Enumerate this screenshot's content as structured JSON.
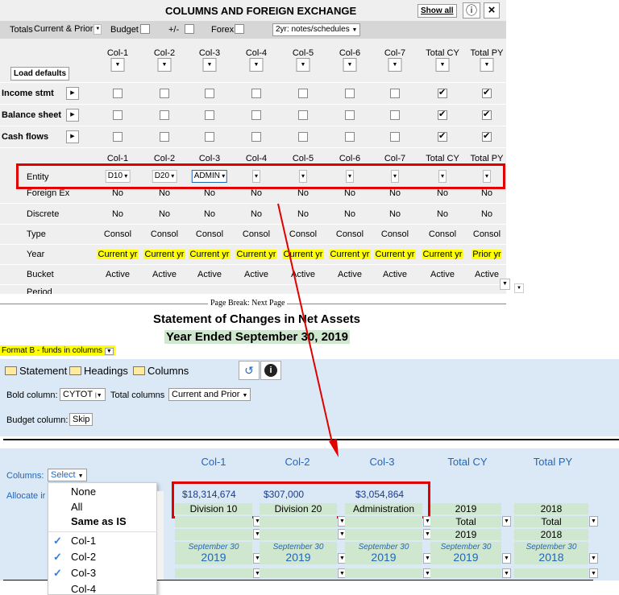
{
  "top": {
    "title": "COLUMNS AND FOREIGN EXCHANGE",
    "show_all": "Show all",
    "info_icon": "ⓘ",
    "close_icon": "×",
    "totals_label": "Totals",
    "totals_value": "Current & Prior",
    "budget_label": "Budget",
    "plusminus_label": "+/-",
    "forex_label": "Forex",
    "notes_value": "2yr: notes/schedules",
    "load_defaults": "Load defaults",
    "columns": [
      "Col-1",
      "Col-2",
      "Col-3",
      "Col-4",
      "Col-5",
      "Col-6",
      "Col-7",
      "Total CY",
      "Total PY"
    ],
    "sections": [
      {
        "label": "Income stmt",
        "checks": [
          false,
          false,
          false,
          false,
          false,
          false,
          false,
          true,
          true
        ]
      },
      {
        "label": "Balance sheet",
        "checks": [
          false,
          false,
          false,
          false,
          false,
          false,
          false,
          true,
          true
        ]
      },
      {
        "label": "Cash flows",
        "checks": [
          false,
          false,
          false,
          false,
          false,
          false,
          false,
          true,
          true
        ]
      }
    ],
    "entity_label": "Entity",
    "entity_values": [
      "D10",
      "D20",
      "ADMIN",
      "",
      "",
      "",
      "",
      "",
      ""
    ],
    "foreignex_label": "Foreign Ex",
    "foreignex_values": [
      "No",
      "No",
      "No",
      "No",
      "No",
      "No",
      "No",
      "No",
      "No"
    ],
    "discrete_label": "Discrete",
    "discrete_values": [
      "No",
      "No",
      "No",
      "No",
      "No",
      "No",
      "No",
      "No",
      "No"
    ],
    "type_label": "Type",
    "type_values": [
      "Consol",
      "Consol",
      "Consol",
      "Consol",
      "Consol",
      "Consol",
      "Consol",
      "Consol",
      "Consol"
    ],
    "year_label": "Year",
    "year_values": [
      "Current yr",
      "Current yr",
      "Current yr",
      "Current yr",
      "Current yr",
      "Current yr",
      "Current yr",
      "Current yr",
      "Prior yr"
    ],
    "bucket_label": "Bucket",
    "bucket_values": [
      "Active",
      "Active",
      "Active",
      "Active",
      "Active",
      "Active",
      "Active",
      "Active",
      "Active"
    ],
    "period_label": "Period"
  },
  "page_break": "Page Break: Next Page",
  "statement": {
    "title": "Statement of Changes in Net Assets",
    "subtitle": "Year Ended September 30, 2019",
    "format": "Format B - funds in columns",
    "tabs": [
      "Statement",
      "Headings",
      "Columns"
    ],
    "bold_label": "Bold column:",
    "bold_value": "CYTOT",
    "total_label": "Total columns",
    "total_value": "Current and Prior",
    "budget_label": "Budget column:",
    "budget_value": "Skip",
    "columns_label": "Columns:",
    "columns_select": "Select",
    "allocate_label": "Allocate ir",
    "headers": [
      "Col-1",
      "Col-2",
      "Col-3",
      "Total CY",
      "Total PY"
    ],
    "amounts": [
      "$18,314,674",
      "$307,000",
      "$3,054,864"
    ],
    "names": [
      "Division 10",
      "Division 20",
      "Administration",
      "2019",
      "2018"
    ],
    "total_row": [
      "Total",
      "Total"
    ],
    "year_row": [
      "2019",
      "2018"
    ],
    "period_label": "September 30",
    "period_years": [
      "2019",
      "2019",
      "2019",
      "2019",
      "2018"
    ]
  },
  "menu": {
    "items": [
      "None",
      "All",
      "Same as IS",
      "Col-1",
      "Col-2",
      "Col-3",
      "Col-4"
    ],
    "checked": [
      false,
      false,
      false,
      true,
      true,
      true,
      false
    ]
  },
  "colors": {
    "highlight": "#e00000",
    "yellow": "#ffff00",
    "blue_panel": "#dbe9f7",
    "green_cell": "#cfe6cf",
    "header_blue": "#2266bb"
  }
}
